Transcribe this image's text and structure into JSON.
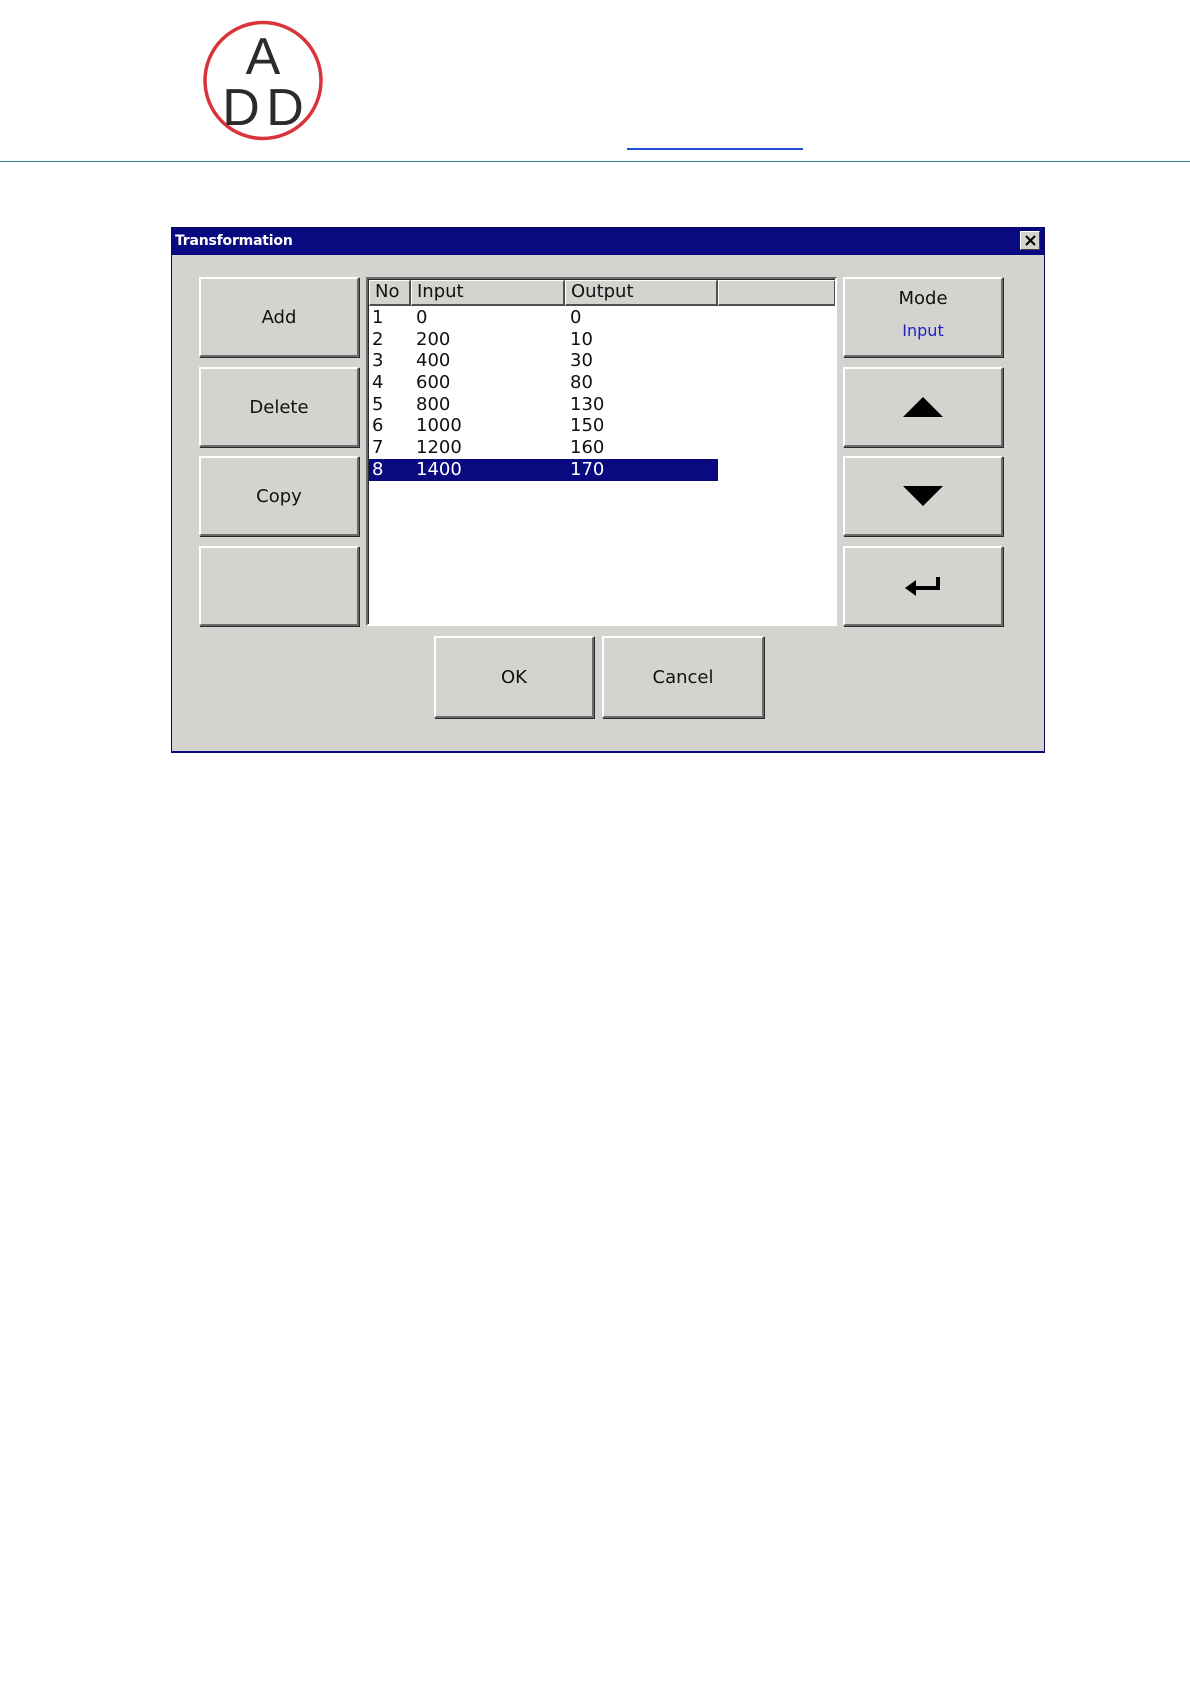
{
  "header": {
    "logo_text": "ADD",
    "logo_colors": {
      "ring": "#d8343a",
      "letters": "#2b2b2b"
    }
  },
  "dialog": {
    "title": "Transformation",
    "colors": {
      "titlebar": "#0a0a80",
      "face": "#d5d3cf",
      "selection": "#0a0a80",
      "mode_value": "#1c22c8"
    },
    "buttons": {
      "add": "Add",
      "delete": "Delete",
      "copy": "Copy",
      "blank": "",
      "mode_label": "Mode",
      "mode_value": "Input",
      "up_icon": "triangle-up-icon",
      "down_icon": "triangle-down-icon",
      "enter_icon": "enter-arrow-icon",
      "ok": "OK",
      "cancel": "Cancel"
    },
    "table": {
      "columns": [
        "No",
        "Input",
        "Output",
        ""
      ],
      "rows": [
        {
          "no": "1",
          "input": "0",
          "output": "0"
        },
        {
          "no": "2",
          "input": "200",
          "output": "10"
        },
        {
          "no": "3",
          "input": "400",
          "output": "30"
        },
        {
          "no": "4",
          "input": "600",
          "output": "80"
        },
        {
          "no": "5",
          "input": "800",
          "output": "130"
        },
        {
          "no": "6",
          "input": "1000",
          "output": "150"
        },
        {
          "no": "7",
          "input": "1200",
          "output": "160"
        },
        {
          "no": "8",
          "input": "1400",
          "output": "170"
        }
      ],
      "selected_row": "8"
    }
  }
}
